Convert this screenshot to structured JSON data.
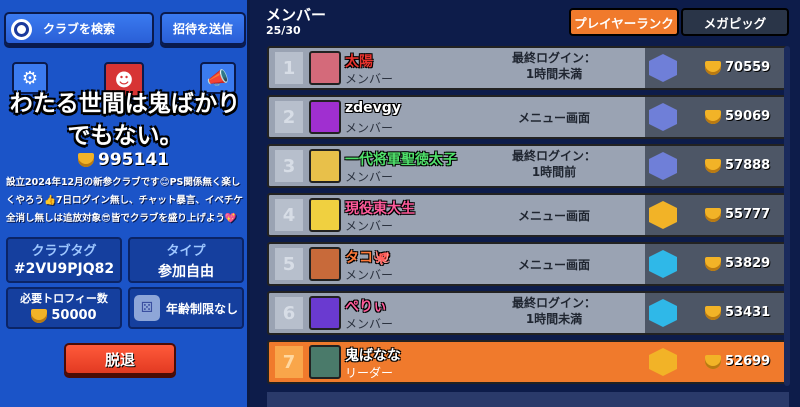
{
  "left_panel": {
    "search_label": "クラブを検索",
    "invite_label": "招待を送信",
    "club_name": "わたる世間は鬼ばかりでもない。",
    "club_trophies": "995141",
    "description": "設立2024年12月の新参クラブです😊PS関係無く楽しくやろう👍7日ログイン無し、チャット暴言、イベチケ全消し無しは追放対象😎皆でクラブを盛り上げよう💖",
    "tag_label": "クラブタグ",
    "tag_value": "#2VU9PJQ82",
    "type_label": "タイプ",
    "type_value": "参加自由",
    "required_trophies_label": "必要トロフィー数",
    "required_trophies_value": "50000",
    "age_label": "年齢制限なし",
    "leave_label": "脱退"
  },
  "right_panel": {
    "title": "メンバー",
    "count": "25/30",
    "tabs": [
      {
        "label": "プレイヤーランク",
        "active": true
      },
      {
        "label": "メガピッグ",
        "active": false
      }
    ]
  },
  "members": [
    {
      "rank": "1",
      "name": "太陽",
      "name_color": "#e8332e",
      "role": "メンバー",
      "status": [
        "最終ログイン：",
        "1時間未満"
      ],
      "trophies": "70559",
      "badge_color": "#6f7fd8",
      "avatar_color": "#d46a7a"
    },
    {
      "rank": "2",
      "name": "zdevgy",
      "name_color": "#ffffff",
      "role": "メンバー",
      "status": [
        "メニュー画面"
      ],
      "trophies": "59069",
      "badge_color": "#6f7fd8",
      "avatar_color": "#a02fd0"
    },
    {
      "rank": "3",
      "name": "一代将軍聖徳太子",
      "name_color": "#4fe06a",
      "role": "メンバー",
      "status": [
        "最終ログイン：",
        "1時間前"
      ],
      "trophies": "57888",
      "badge_color": "#6f7fd8",
      "avatar_color": "#e8c04a"
    },
    {
      "rank": "4",
      "name": "現役東大生",
      "name_color": "#ff5a9a",
      "role": "メンバー",
      "status": [
        "メニュー画面"
      ],
      "trophies": "55777",
      "badge_color": "#f2b327",
      "avatar_color": "#f0d040"
    },
    {
      "rank": "5",
      "name": "タコ🐙",
      "name_color": "#ff7a3a",
      "role": "メンバー",
      "status": [
        "メニュー画面"
      ],
      "trophies": "53829",
      "badge_color": "#2fb8e8",
      "avatar_color": "#c86a3a"
    },
    {
      "rank": "6",
      "name": "ぺりぃ",
      "name_color": "#ff5a9a",
      "role": "メンバー",
      "status": [
        "最終ログイン：",
        "1時間未満"
      ],
      "trophies": "53431",
      "badge_color": "#2fb8e8",
      "avatar_color": "#6a3ad0"
    },
    {
      "rank": "7",
      "name": "鬼ばなな",
      "name_color": "#ffffff",
      "role": "リーダー",
      "status": [],
      "trophies": "52699",
      "badge_color": "#f2b327",
      "avatar_color": "#4a7a6a"
    }
  ]
}
